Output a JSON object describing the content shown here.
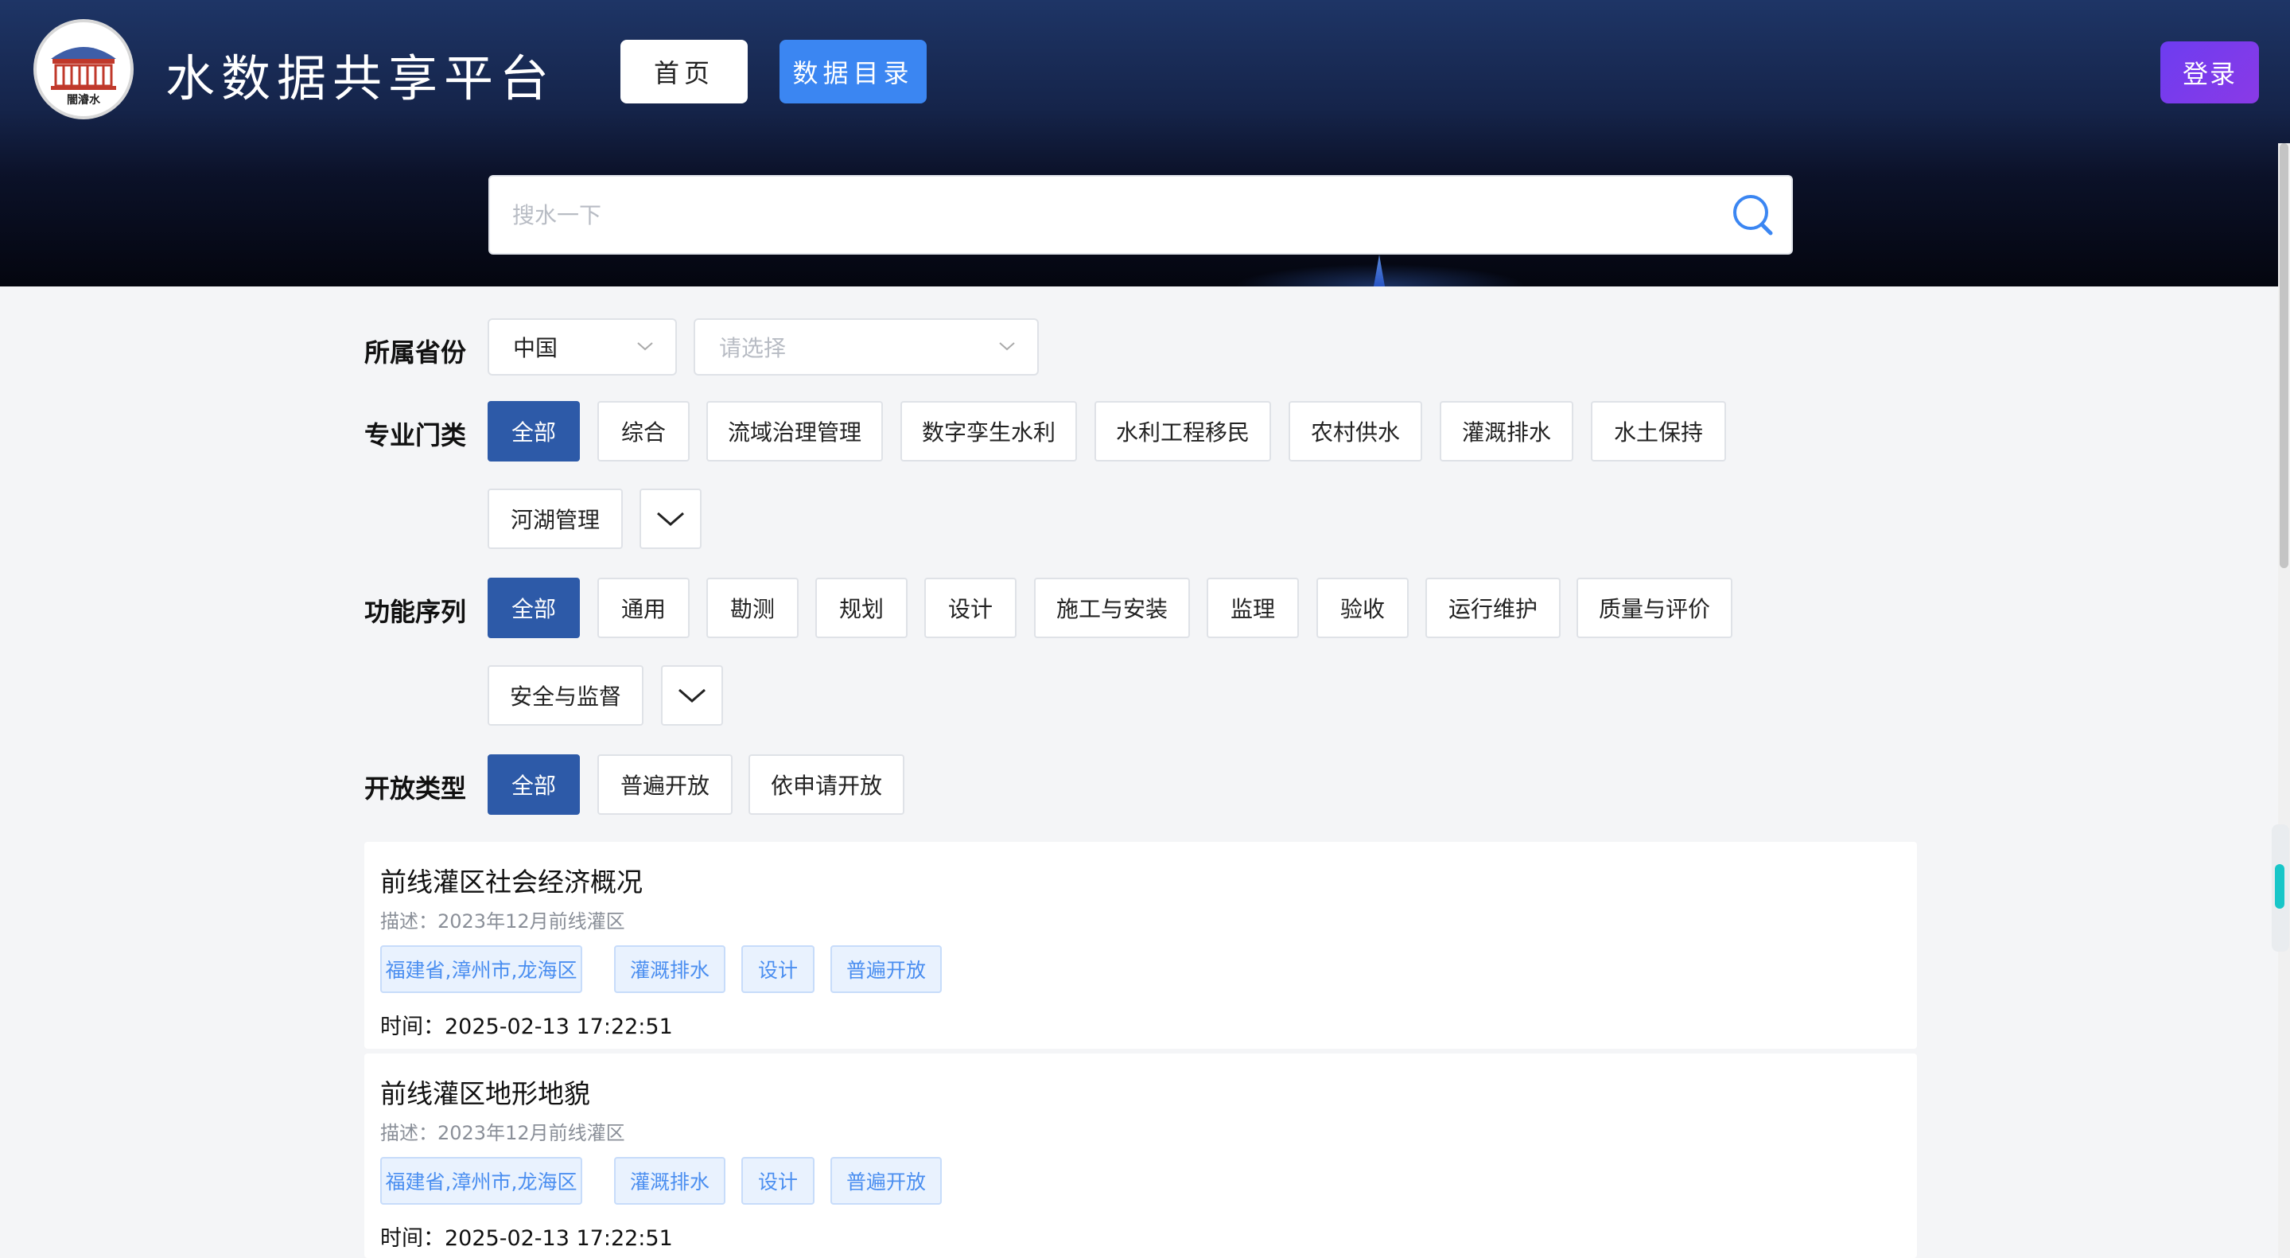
{
  "header": {
    "logo_text": "闇濬水",
    "site_title": "水数据共享平台",
    "nav": {
      "home": "首页",
      "catalog": "数据目录"
    },
    "login": "登录",
    "search_placeholder": "搜水一下"
  },
  "filters": {
    "province": {
      "label": "所属省份",
      "country_value": "中国",
      "province_placeholder": "请选择"
    },
    "discipline": {
      "label": "专业门类",
      "items": [
        "全部",
        "综合",
        "流域治理管理",
        "数字孪生水利",
        "水利工程移民",
        "农村供水",
        "灌溉排水",
        "水土保持",
        "河湖管理"
      ]
    },
    "function": {
      "label": "功能序列",
      "items": [
        "全部",
        "通用",
        "勘测",
        "规划",
        "设计",
        "施工与安装",
        "监理",
        "验收",
        "运行维护",
        "质量与评价",
        "安全与监督"
      ]
    },
    "open_type": {
      "label": "开放类型",
      "items": [
        "全部",
        "普遍开放",
        "依申请开放"
      ]
    }
  },
  "results": [
    {
      "title": "前线灌区社会经济概况",
      "desc": "描述：2023年12月前线灌区",
      "tags": [
        "福建省,漳州市,龙海区",
        "灌溉排水",
        "设计",
        "普遍开放"
      ],
      "time": "时间：2025-02-13 17:22:51"
    },
    {
      "title": "前线灌区地形地貌",
      "desc": "描述：2023年12月前线灌区",
      "tags": [
        "福建省,漳州市,龙海区",
        "灌溉排水",
        "设计",
        "普遍开放"
      ],
      "time": "时间：2025-02-13 17:22:51"
    }
  ],
  "colors": {
    "active_chip": "#2d5aa8",
    "catalog_button": "#3b86f2",
    "login_button": "#7a3bee",
    "tag_text": "#4a8ef0"
  }
}
